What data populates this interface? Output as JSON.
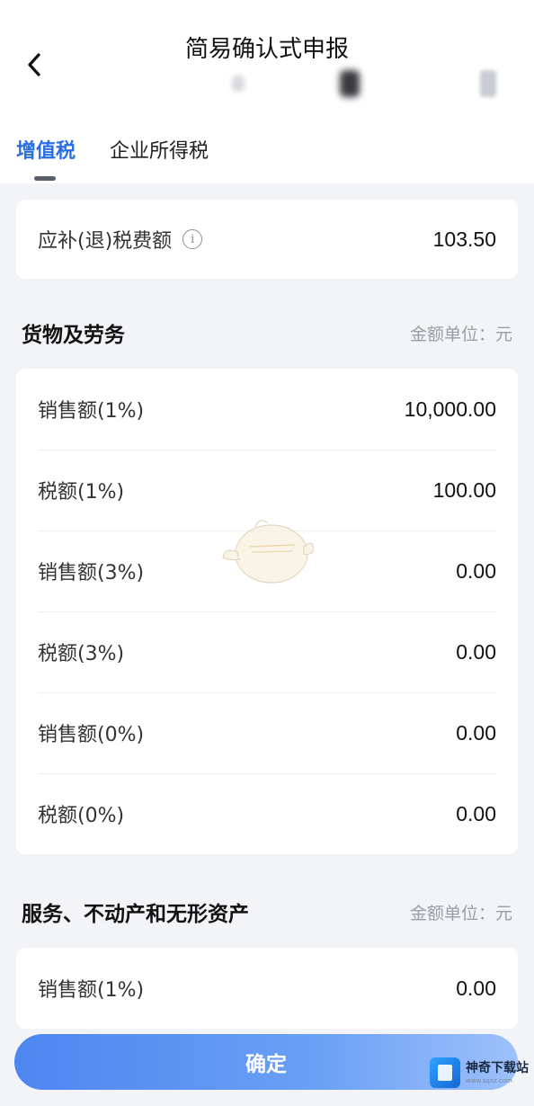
{
  "header": {
    "title": "简易确认式申报",
    "back_icon": "chevron-left-icon"
  },
  "tabs": [
    {
      "label": "增值税",
      "active": true
    },
    {
      "label": "企业所得税",
      "active": false
    }
  ],
  "summary": {
    "label": "应补(退)税费额",
    "value": "103.50",
    "info_icon": "info-icon"
  },
  "goods_section": {
    "title": "货物及劳务",
    "unit_label": "金额单位：元",
    "rows": [
      {
        "label": "销售额(1%)",
        "value": "10,000.00"
      },
      {
        "label": "税额(1%)",
        "value": "100.00"
      },
      {
        "label": "销售额(3%)",
        "value": "0.00"
      },
      {
        "label": "税额(3%)",
        "value": "0.00"
      },
      {
        "label": "销售额(0%)",
        "value": "0.00"
      },
      {
        "label": "税额(0%)",
        "value": "0.00"
      }
    ]
  },
  "services_section": {
    "title": "服务、不动产和无形资产",
    "unit_label": "金额单位：元",
    "rows": [
      {
        "label": "销售额(1%)",
        "value": "0.00"
      }
    ]
  },
  "confirm_button": {
    "label": "确定"
  },
  "watermark": {
    "title": "神奇下载站",
    "url": "www.sqxz.com"
  },
  "colors": {
    "accent": "#2b6fe6",
    "background": "#f3f4f7",
    "button": "#5a8ff2"
  }
}
